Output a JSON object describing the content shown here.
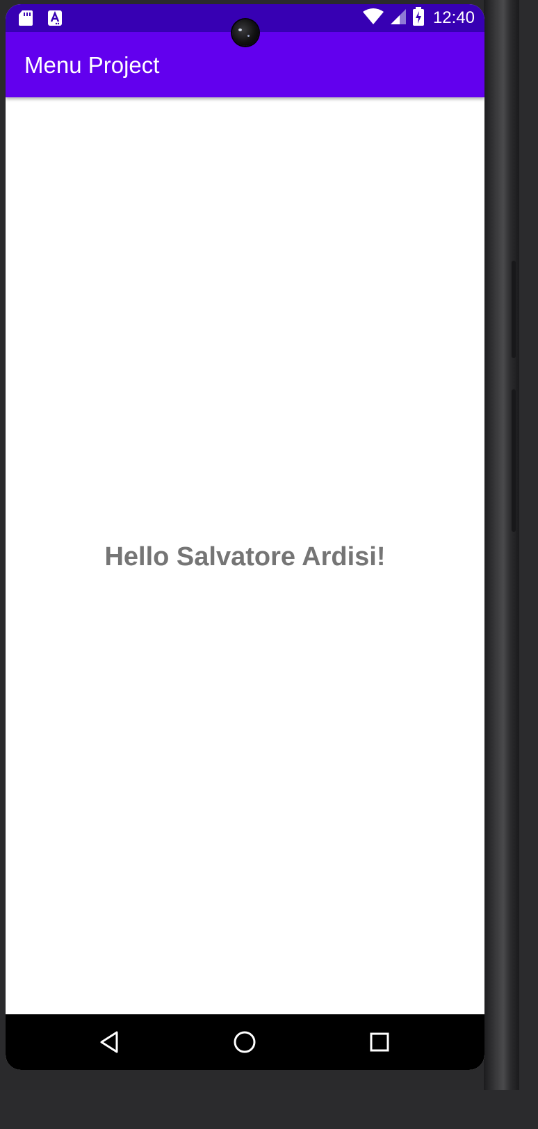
{
  "status_bar": {
    "time": "12:40",
    "left_icons": [
      "sd-card-icon",
      "accessibility-notification-icon"
    ],
    "right_icons": [
      "wifi-icon",
      "cell-signal-icon",
      "battery-charging-icon"
    ],
    "background_color": "#3700b3"
  },
  "app_bar": {
    "title": "Menu Project",
    "background_color": "#6200ee"
  },
  "content": {
    "greeting": "Hello Salvatore Ardisi!",
    "text_color": "#757575"
  },
  "nav_bar": {
    "buttons": [
      "back-icon",
      "home-icon",
      "recents-icon"
    ]
  }
}
